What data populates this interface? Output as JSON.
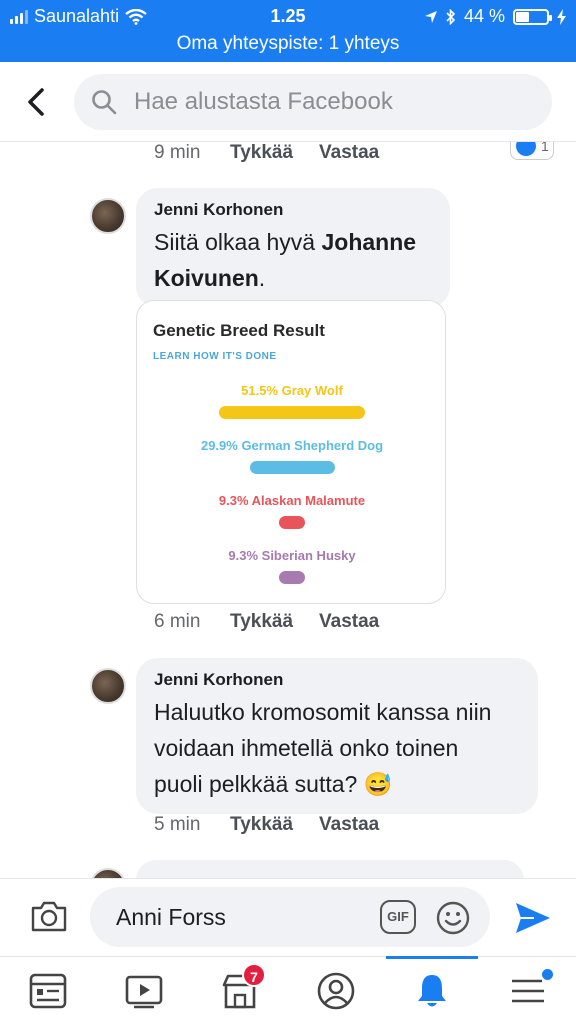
{
  "status_bar": {
    "carrier": "Saunalahti",
    "time": "1.25",
    "battery": "44 %",
    "battery_level": 0.44,
    "hotspot": "Oma yhteyspiste: 1 yhteys"
  },
  "header": {
    "search_placeholder": "Hae alustasta Facebook"
  },
  "comments": [
    {
      "time": "9 min",
      "like": "Tykkää",
      "reply": "Vastaa",
      "reaction_count": "1"
    },
    {
      "author": "Jenni Korhonen",
      "text_pre": "Siitä olkaa hyvä ",
      "text_bold": "Johanne Koivunen",
      "text_post": ".",
      "time": "6 min",
      "like": "Tykkää",
      "reply": "Vastaa",
      "attachment": {
        "title": "Genetic Breed Result",
        "link": "LEARN HOW IT'S DONE",
        "breeds": [
          {
            "label": "51.5% Gray Wolf",
            "percent": 51.5,
            "color": "#f5c518"
          },
          {
            "label": "29.9% German Shepherd Dog",
            "percent": 29.9,
            "color": "#5bbce4"
          },
          {
            "label": "9.3% Alaskan Malamute",
            "percent": 9.3,
            "color": "#e8545a"
          },
          {
            "label": "9.3% Siberian Husky",
            "percent": 9.3,
            "color": "#a77ab0"
          }
        ]
      }
    },
    {
      "author": "Jenni Korhonen",
      "text_line1": "Haluutko kromosomit kanssa niin",
      "text_line2": "voidaan ihmetellä onko toinen",
      "text_line3": "puoli pelkkää sutta? 😅",
      "time": "5 min",
      "like": "Tykkää",
      "reply": "Vastaa"
    }
  ],
  "compose": {
    "value": "Anni Forss",
    "gif_label": "GIF"
  },
  "tabbar": {
    "marketplace_badge": "7"
  },
  "colors": {
    "accent": "#1a7ef2",
    "badge": "#e41e3f"
  }
}
